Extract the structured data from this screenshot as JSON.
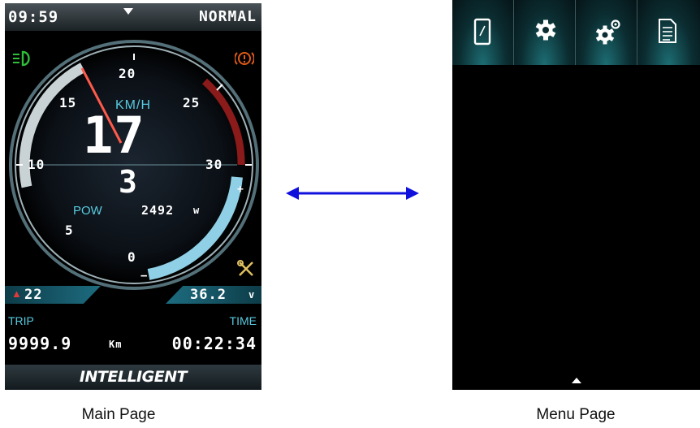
{
  "main": {
    "clock": "09:59",
    "mode": "NORMAL",
    "speed_unit": "KM/H",
    "speed": "17",
    "gear": "3",
    "power_label": "POW",
    "power_value": "2492",
    "power_unit": "w",
    "ticks": [
      "0",
      "5",
      "10",
      "15",
      "20",
      "25",
      "30"
    ],
    "error_count": "22",
    "voltage_value": "36.2",
    "voltage_unit": "v",
    "battery_plus": "+",
    "battery_minus": "−",
    "trip_label": "TRIP",
    "trip_value": "9999.9",
    "trip_unit": "Km",
    "time_label": "TIME",
    "time_value": "00:22:34",
    "assist_label": "INTELLIGENT"
  },
  "menu": {
    "tabs": [
      {
        "icon": "phone-icon"
      },
      {
        "icon": "gear-icon"
      },
      {
        "icon": "gears-icon"
      },
      {
        "icon": "document-icon"
      }
    ]
  },
  "captions": {
    "main": "Main Page",
    "menu": "Menu Page"
  },
  "colors": {
    "arrow": "#1010dd",
    "accent": "#58cbe0",
    "redline": "#9b1c1c",
    "headlight": "#2fbf3a",
    "warning": "#e05a1a"
  }
}
